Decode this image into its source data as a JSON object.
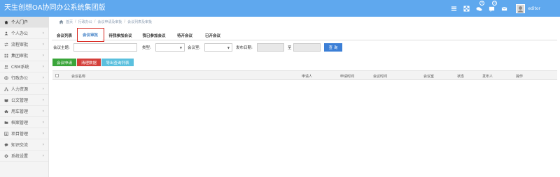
{
  "header": {
    "app_title": "天生创想OA协同办公系统集团版",
    "badges": {
      "chat": "0",
      "alerts": "0"
    },
    "username": "editor"
  },
  "sidebar": {
    "items": [
      {
        "label": "个人门户",
        "icon": "home-icon",
        "active": true,
        "has_chevron": false
      },
      {
        "label": "个人办公",
        "icon": "user-icon",
        "has_chevron": true
      },
      {
        "label": "流程审批",
        "icon": "exchange-icon",
        "has_chevron": true
      },
      {
        "label": "集团审批",
        "icon": "grid-icon",
        "has_chevron": true
      },
      {
        "label": "CRM系统",
        "icon": "users-icon",
        "has_chevron": true
      },
      {
        "label": "行政办公",
        "icon": "globe-icon",
        "has_chevron": true
      },
      {
        "label": "人力资源",
        "icon": "sitemap-icon",
        "has_chevron": true
      },
      {
        "label": "公文管理",
        "icon": "book-icon",
        "has_chevron": true
      },
      {
        "label": "用车管理",
        "icon": "car-icon",
        "has_chevron": true
      },
      {
        "label": "档案管理",
        "icon": "folder-icon",
        "has_chevron": true
      },
      {
        "label": "项目管理",
        "icon": "list-icon",
        "has_chevron": true
      },
      {
        "label": "知识交流",
        "icon": "chat-icon",
        "has_chevron": true
      },
      {
        "label": "系统设置",
        "icon": "gear-icon",
        "has_chevron": true
      }
    ]
  },
  "breadcrumb": [
    "首页",
    "行政办公",
    "会议申请及审批",
    "会议列表及审批"
  ],
  "tabs": [
    {
      "label": "会议列表"
    },
    {
      "label": "会议审批",
      "active": true
    },
    {
      "label": "待我参加会议"
    },
    {
      "label": "我已参加会议"
    },
    {
      "label": "待开会议"
    },
    {
      "label": "已开会议"
    }
  ],
  "filters": {
    "subject_label": "会议主题:",
    "type_label": "类型:",
    "room_label": "会议室:",
    "date_label": "发布日期:",
    "to_label": "至",
    "query_button": "查 询"
  },
  "actions": {
    "apply": "会议申请",
    "clear": "清理数据",
    "export": "导出查询列表"
  },
  "table": {
    "columns": [
      "会议名称",
      "申请人",
      "申请时间",
      "会议时间",
      "会议室",
      "状态",
      "发布人",
      "操作"
    ]
  },
  "colors": {
    "topbar": "#5fa8ee",
    "accent": "#3c7fd6",
    "highlight_box": "#d9251d",
    "btn_green": "#3aa53a",
    "btn_red": "#d43f3a",
    "btn_cyan": "#5bc0de"
  }
}
